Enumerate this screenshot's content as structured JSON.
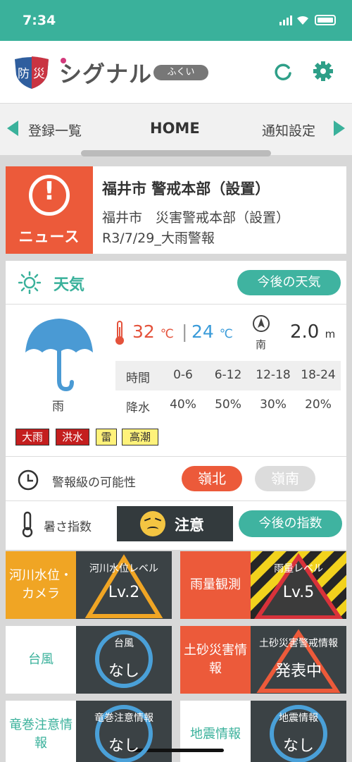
{
  "status": {
    "time": "7:34"
  },
  "header": {
    "shield_chars": "防災",
    "brand": "シグナル",
    "prefecture": "ふくい"
  },
  "tabs": {
    "prev": "登録一覧",
    "current": "HOME",
    "next": "通知設定"
  },
  "news": {
    "badge": "ニュース",
    "title": "福井市 警戒本部（設置）",
    "line1": "福井市　災害警戒本部（設置）",
    "line2": "R3/7/29_大雨警報"
  },
  "weather": {
    "title": "天気",
    "more_button": "今後の天気",
    "condition": "雨",
    "temp_max": "32",
    "temp_min": "24",
    "temp_unit": "℃",
    "wind_dir": "南",
    "wind_speed": "2.0",
    "wind_unit": "m",
    "rain_table": {
      "time_label": "時間",
      "rain_label": "降水",
      "periods": [
        "0-6",
        "6-12",
        "12-18",
        "18-24"
      ],
      "values": [
        "40%",
        "50%",
        "30%",
        "20%"
      ]
    },
    "warnings": [
      {
        "label": "大雨",
        "bg": "#c41e1e",
        "fg": "#ffffff"
      },
      {
        "label": "洪水",
        "bg": "#c41e1e",
        "fg": "#ffffff"
      },
      {
        "label": "雷",
        "bg": "#fff27a",
        "fg": "#333333"
      },
      {
        "label": "高潮",
        "bg": "#fff27a",
        "fg": "#333333"
      }
    ],
    "possibility_label": "警報級の可能性",
    "region_north": "嶺北",
    "region_south": "嶺南",
    "heat_label": "暑さ指数",
    "heat_value": "注意",
    "heat_button": "今後の指数"
  },
  "tiles": {
    "river": {
      "label": "河川水位・カメラ",
      "caption": "河川水位レベル",
      "value": "Lv.2"
    },
    "rain": {
      "label": "雨量観測",
      "caption": "雨量レベル",
      "value": "Lv.5"
    },
    "typhoon": {
      "label": "台風",
      "caption": "台風",
      "value": "なし"
    },
    "landslide": {
      "label": "土砂災害情報",
      "caption": "土砂災害警戒情報",
      "value": "発表中"
    },
    "tornado": {
      "label": "竜巻注意情報",
      "caption": "竜巻注意情報",
      "value": "なし"
    },
    "quake": {
      "label": "地震情報",
      "caption": "地震情報",
      "value": "なし"
    }
  },
  "colors": {
    "accent": "#3ab19b",
    "alert": "#ec5a3a",
    "dark": "#3b4245",
    "river": "#f0a524"
  }
}
